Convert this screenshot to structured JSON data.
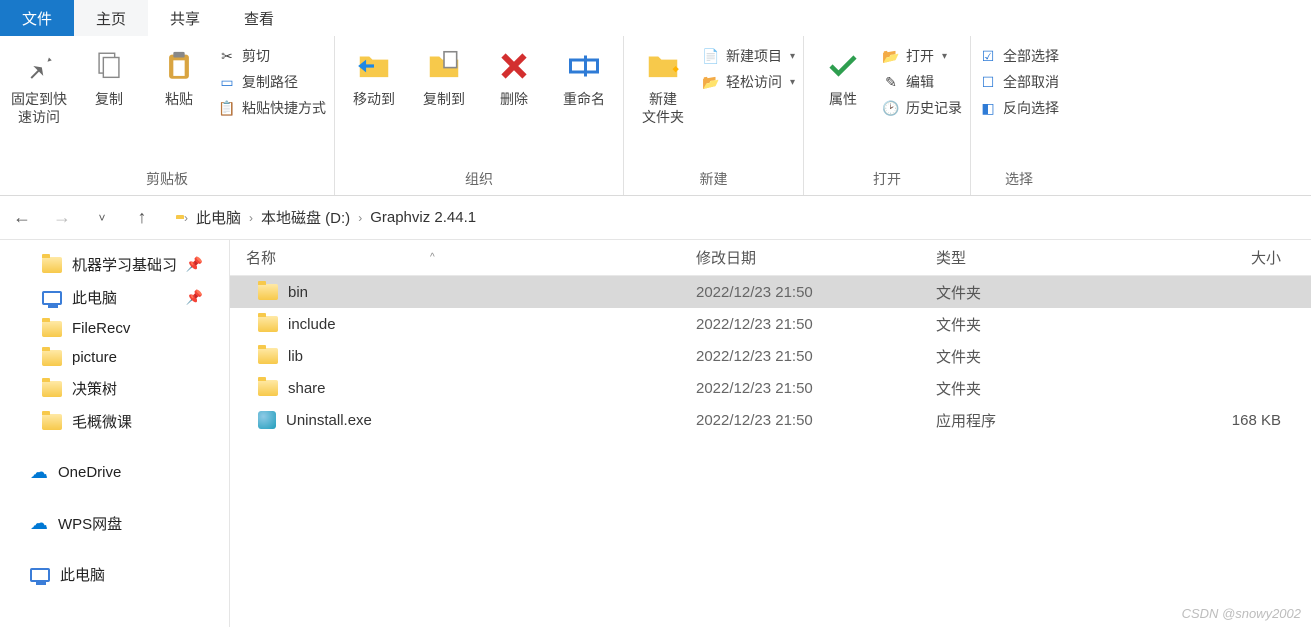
{
  "tabs": {
    "file": "文件",
    "home": "主页",
    "share": "共享",
    "view": "查看"
  },
  "ribbon": {
    "clipboard": {
      "label": "剪贴板",
      "pin": "固定到快速访问",
      "copy": "复制",
      "paste": "粘贴",
      "cut": "剪切",
      "copy_path": "复制路径",
      "paste_shortcut": "粘贴快捷方式"
    },
    "organize": {
      "label": "组织",
      "move_to": "移动到",
      "copy_to": "复制到",
      "delete": "删除",
      "rename": "重命名"
    },
    "new": {
      "label": "新建",
      "new_folder": "新建\n文件夹",
      "new_item": "新建项目",
      "easy_access": "轻松访问"
    },
    "open": {
      "label": "打开",
      "properties": "属性",
      "open": "打开",
      "edit": "编辑",
      "history": "历史记录"
    },
    "select": {
      "label": "选择",
      "select_all": "全部选择",
      "select_none": "全部取消",
      "invert": "反向选择"
    }
  },
  "breadcrumb": {
    "pc": "此电脑",
    "drive": "本地磁盘 (D:)",
    "folder": "Graphviz 2.44.1"
  },
  "sidebar": {
    "items": [
      {
        "label": "机器学习基础习",
        "icon": "folder",
        "pinned": true
      },
      {
        "label": "此电脑",
        "icon": "pc",
        "pinned": true
      },
      {
        "label": "FileRecv",
        "icon": "folder"
      },
      {
        "label": "picture",
        "icon": "folder"
      },
      {
        "label": "决策树",
        "icon": "folder"
      },
      {
        "label": "毛概微课",
        "icon": "folder"
      }
    ],
    "onedrive": "OneDrive",
    "wps": "WPS网盘",
    "thispc": "此电脑"
  },
  "columns": {
    "name": "名称",
    "date": "修改日期",
    "type": "类型",
    "size": "大小"
  },
  "files": [
    {
      "name": "bin",
      "date": "2022/12/23 21:50",
      "type": "文件夹",
      "size": "",
      "icon": "folder",
      "selected": true
    },
    {
      "name": "include",
      "date": "2022/12/23 21:50",
      "type": "文件夹",
      "size": "",
      "icon": "folder"
    },
    {
      "name": "lib",
      "date": "2022/12/23 21:50",
      "type": "文件夹",
      "size": "",
      "icon": "folder"
    },
    {
      "name": "share",
      "date": "2022/12/23 21:50",
      "type": "文件夹",
      "size": "",
      "icon": "folder"
    },
    {
      "name": "Uninstall.exe",
      "date": "2022/12/23 21:50",
      "type": "应用程序",
      "size": "168 KB",
      "icon": "exe"
    }
  ],
  "watermark": "CSDN @snowy2002"
}
